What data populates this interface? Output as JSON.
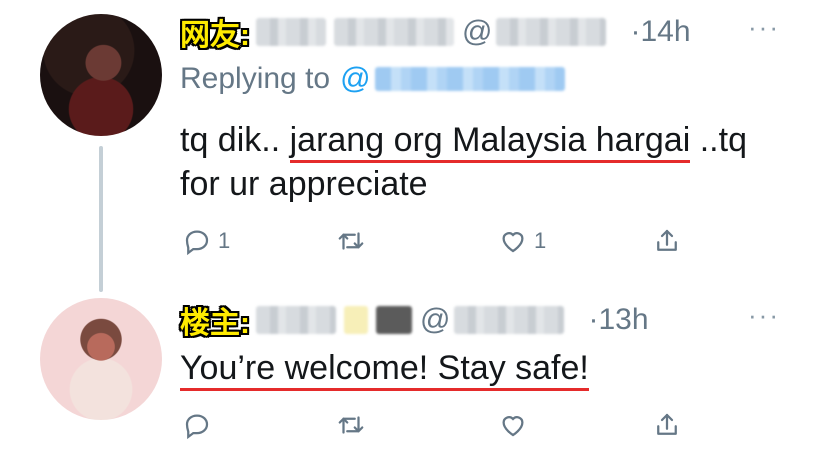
{
  "tweets": [
    {
      "role_label": "网友:",
      "handle_prefix": "@",
      "time": "14h",
      "more_icon": "···",
      "replying_prefix": "Replying to",
      "replying_mention_prefix": "@",
      "text_before": "tq dik.. ",
      "text_underlined": "jarang org Malaysia hargai",
      "text_after": " ..tq for ur appreciate",
      "reply_count": "1",
      "retweet_count": "",
      "like_count": "1"
    },
    {
      "role_label": "楼主:",
      "handle_prefix": "@",
      "time": "13h",
      "more_icon": "···",
      "text_underlined": "You’re welcome! Stay safe!",
      "reply_count": "",
      "retweet_count": "",
      "like_count": ""
    }
  ],
  "colors": {
    "accent_blue": "#1da1f2",
    "badge_yellow": "#ffeb00",
    "underline_red": "#e52b2b",
    "muted_gray": "#657786"
  },
  "icons": [
    "comment-icon",
    "retweet-icon",
    "like-icon",
    "share-icon",
    "more-icon"
  ]
}
